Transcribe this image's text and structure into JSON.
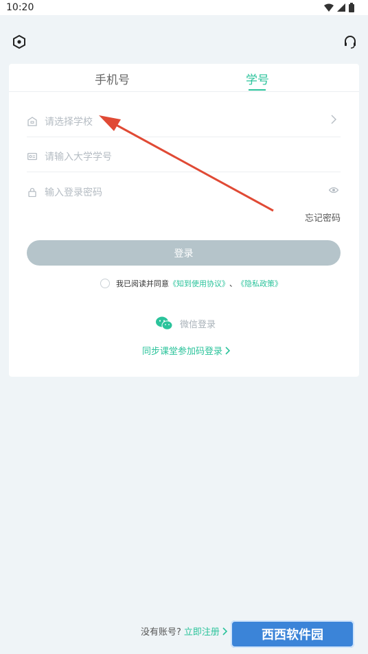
{
  "status_bar": {
    "time": "10:20",
    "icons": [
      "wifi-icon",
      "cell-signal-icon",
      "battery-icon"
    ]
  },
  "tabs": [
    {
      "label": "手机号",
      "active": false
    },
    {
      "label": "学号",
      "active": true
    }
  ],
  "form": {
    "school_placeholder": "请选择学校",
    "student_id_placeholder": "请输入大学学号",
    "password_placeholder": "输入登录密码",
    "forgot_password": "忘记密码",
    "login_button": "登录"
  },
  "agreement": {
    "prefix": "我已阅读并同意",
    "terms": "《知到使用协议》",
    "separator": "、",
    "privacy": "《隐私政策》"
  },
  "wechat_login": "微信登录",
  "sync_classroom": "同步课堂参加码登录",
  "footer": {
    "prompt": "没有账号?",
    "register": "立即注册"
  },
  "watermark": {
    "text": "西西软件园"
  },
  "colors": {
    "accent": "#2bc39b",
    "button_disabled": "#b5c4ca",
    "background": "#eff4f7",
    "annotation_arrow": "#e04a35"
  }
}
